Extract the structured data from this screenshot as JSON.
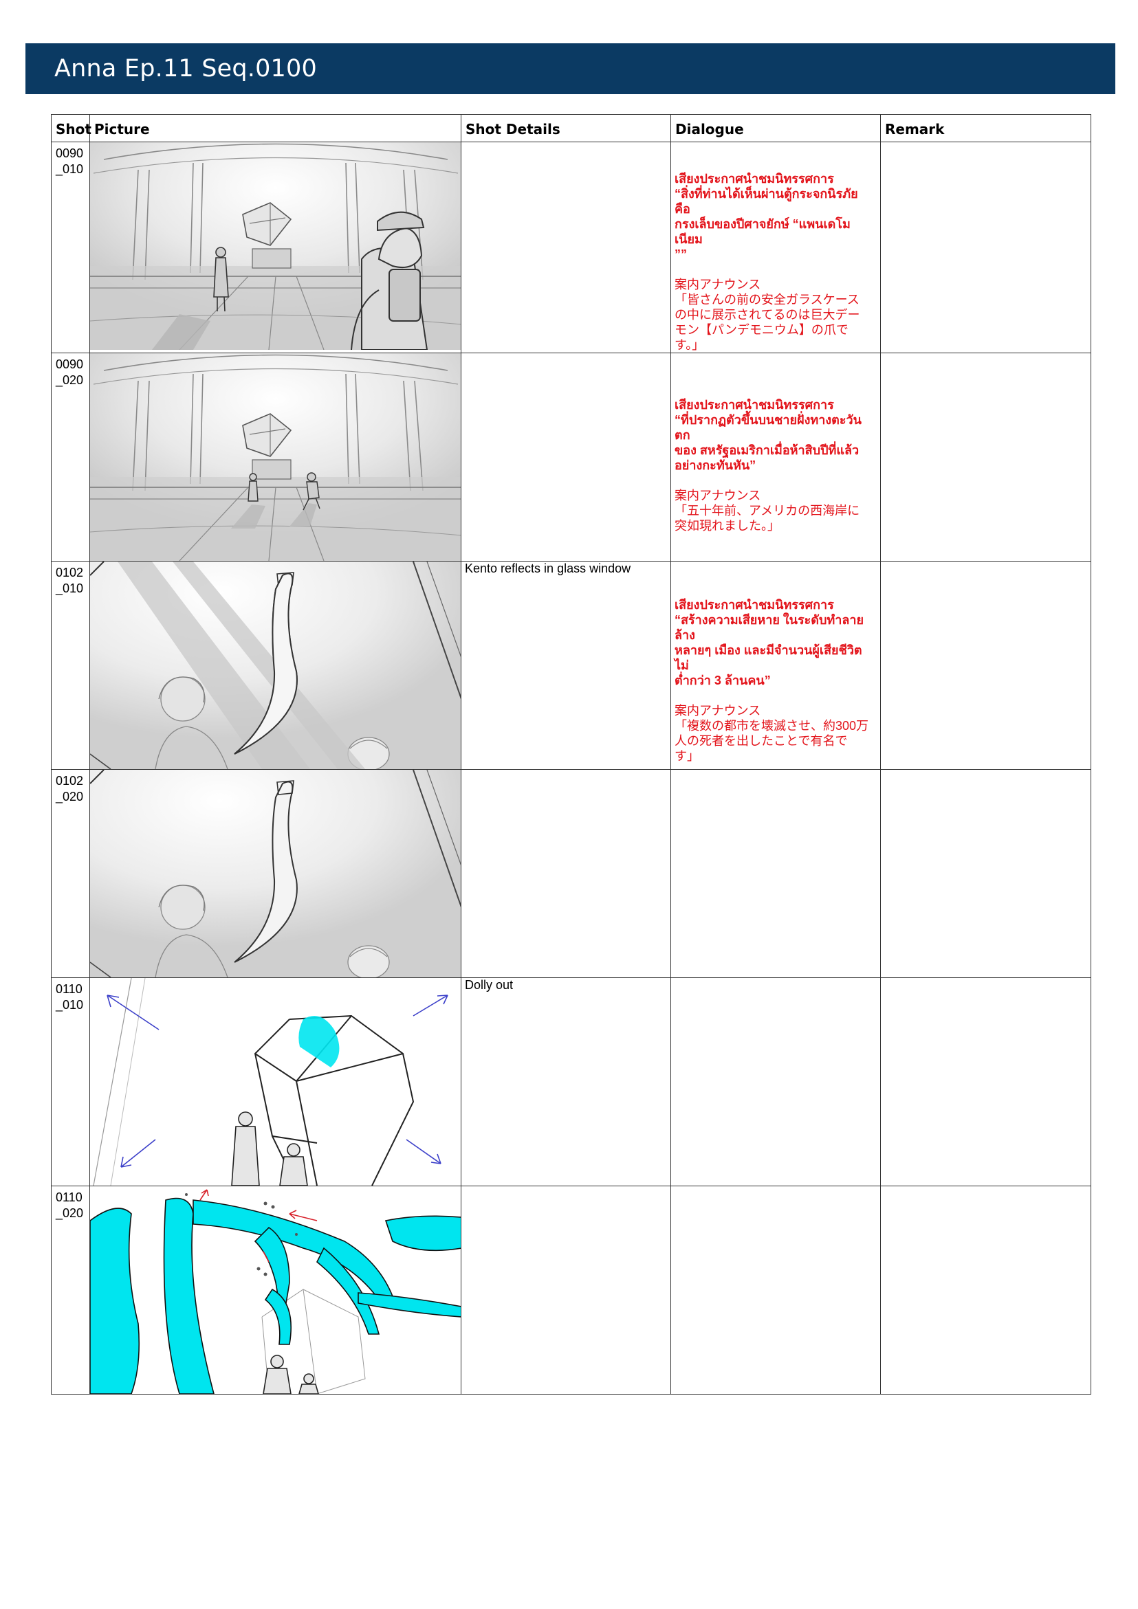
{
  "page": {
    "title": "Anna Ep.11 Seq.0100"
  },
  "table": {
    "headers": {
      "shot": "Shot",
      "picture": "Picture",
      "details": "Shot Details",
      "dialogue": "Dialogue",
      "remark": "Remark"
    },
    "rows": [
      {
        "shot": "0090\n_010",
        "details": "",
        "dialogue_th": "เสียงประกาศนำชมนิทรรศการ\n“สิ่งที่ท่านได้เห็นผ่านตู้กระจกนิรภัย คือ\nกรงเล็บของปีศาจยักษ์ “แพนเดโมเนียม\n””",
        "dialogue_jp": "案内アナウンス\n「皆さんの前の安全ガラスケース\nの中に展示されてるのは巨大デー\nモン【パンデモニウム】の爪で\nす。」",
        "remark": ""
      },
      {
        "shot": "0090\n_020",
        "details": "",
        "dialogue_th": "เสียงประกาศนำชมนิทรรศการ\n“ที่ปรากฏตัวขึ้นบนชายฝั่งทางตะวันตก\nของ สหรัฐอเมริกาเมื่อห้าสิบปีที่แล้ว\nอย่างกะทันหัน”",
        "dialogue_jp": "案内アナウンス\n「五十年前、アメリカの西海岸に\n突如現れました。」",
        "remark": ""
      },
      {
        "shot": "0102\n_010",
        "details": "Kento reflects in glass window",
        "dialogue_th": "เสียงประกาศนำชมนิทรรศการ\n“สร้างความเสียหาย ในระดับทำลายล้าง\nหลายๆ เมือง และมีจำนวนผู้เสียชีวิตไม่\nต่ำกว่า 3 ล้านคน”",
        "dialogue_jp": "案内アナウンス\n「複数の都市を壊滅させ、約300万\n人の死者を出したことで有名で\nす」",
        "remark": ""
      },
      {
        "shot": "0102\n_020",
        "details": "",
        "dialogue_th": "",
        "dialogue_jp": "",
        "remark": ""
      },
      {
        "shot": "0110\n_010",
        "details": "Dolly out",
        "dialogue_th": "",
        "dialogue_jp": "",
        "remark": ""
      },
      {
        "shot": "0110\n_020",
        "details": "",
        "dialogue_th": "",
        "dialogue_jp": "",
        "remark": ""
      }
    ]
  },
  "colors": {
    "title_bar": "#0b3a63",
    "dialogue_text": "#e3141b",
    "highlight_cyan": "#00e5ef",
    "arrow_blue": "#3b3fc9",
    "arrow_red": "#d8202a"
  }
}
